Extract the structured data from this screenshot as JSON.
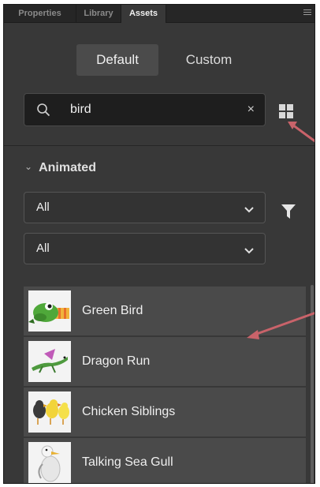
{
  "tabs": [
    {
      "label": "Properties",
      "active": false
    },
    {
      "label": "Library",
      "active": false
    },
    {
      "label": "Assets",
      "active": true
    }
  ],
  "mode_toggle": {
    "options": [
      {
        "label": "Default",
        "selected": true
      },
      {
        "label": "Custom",
        "selected": false
      }
    ]
  },
  "search": {
    "value": "bird",
    "clear_label": "×",
    "icon": "search-icon"
  },
  "grid_view_icon": "grid-view-icon",
  "section": {
    "title": "Animated",
    "expanded": true
  },
  "filters": [
    {
      "value": "All"
    },
    {
      "value": "All"
    }
  ],
  "filter_icon": "funnel-icon",
  "assets": [
    {
      "name": "Green Bird",
      "thumb": "green-bird-thumbnail"
    },
    {
      "name": "Dragon Run",
      "thumb": "dragon-run-thumbnail"
    },
    {
      "name": "Chicken Siblings",
      "thumb": "chicken-siblings-thumbnail"
    },
    {
      "name": "Talking Sea Gull",
      "thumb": "sea-gull-thumbnail"
    }
  ],
  "colors": {
    "panel_bg": "#383838",
    "tabbar_bg": "#262626",
    "input_bg": "#1e1e1e",
    "row_bg": "#4a4a4a",
    "annotation_arrow": "#c9636a"
  }
}
